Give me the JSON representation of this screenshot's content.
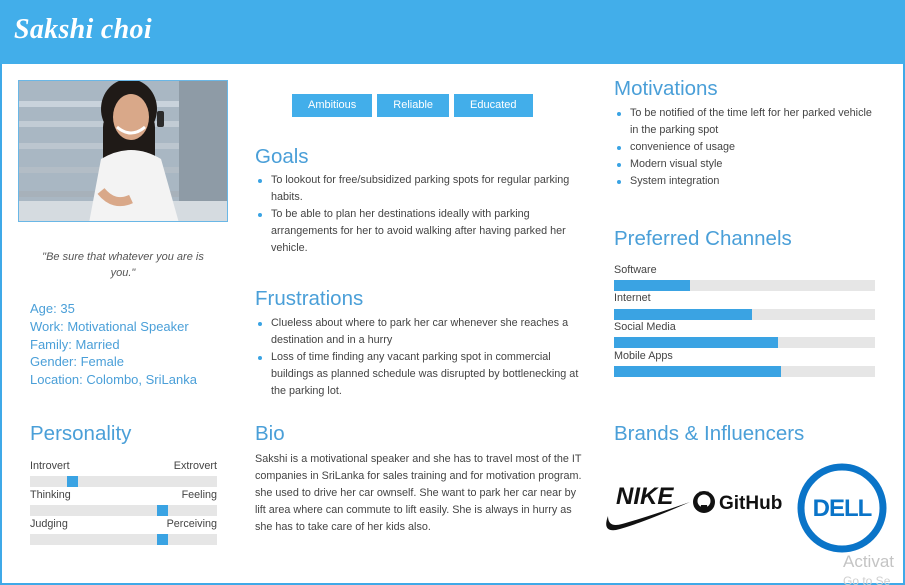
{
  "persona": {
    "name": "Sakshi choi",
    "quote": "\"Be sure that whatever you are is you.\"",
    "facts": [
      "Age: 35",
      "Work: Motivational Speaker",
      "Family: Married",
      "Gender: Female",
      "Location: Colombo, SriLanka"
    ],
    "tags": [
      "Ambitious",
      "Reliable",
      "Educated"
    ]
  },
  "goals": {
    "title": "Goals",
    "items": [
      "To lookout for free/subsidized parking spots for regular parking habits.",
      "To be able to plan her destinations ideally with parking arrangements for her to avoid walking after having parked her vehicle."
    ]
  },
  "frustrations": {
    "title": "Frustrations",
    "items": [
      "Clueless about where to park her car whenever she reaches a destination and in a hurry",
      "Loss of time finding any vacant parking spot in commercial buildings as planned schedule was disrupted by bottlenecking at the parking lot."
    ]
  },
  "motivations": {
    "title": "Motivations",
    "items": [
      "To be notified of the time left for her parked vehicle in the parking spot",
      "convenience of usage",
      "Modern visual style",
      "System integration"
    ]
  },
  "channels": {
    "title": "Preferred Channels",
    "items": [
      {
        "label": "Software",
        "level": 0.29
      },
      {
        "label": "Internet",
        "level": 0.53
      },
      {
        "label": "Social Media",
        "level": 0.63
      },
      {
        "label": "Mobile Apps",
        "level": 0.64
      }
    ]
  },
  "personality": {
    "title": "Personality",
    "traits": [
      {
        "left": "Introvert",
        "right": "Extrovert",
        "level": 0.21
      },
      {
        "left": "Thinking",
        "right": "Feeling",
        "level": 0.72
      },
      {
        "left": "Judging",
        "right": "Perceiving",
        "level": 0.72
      }
    ]
  },
  "bio": {
    "title": "Bio",
    "text": "Sakshi is a motivational speaker  and she has to travel most of the IT companies in SriLanka for sales training and for motivation program. she used to drive her car ownself. She want to park her car near by lift area where can commute to lift easily. She is always in hurry as she has to take care of her kids also."
  },
  "brands": {
    "title": "Brands & Influencers",
    "logos": [
      {
        "name": "nike-logo",
        "text": "NIKE"
      },
      {
        "name": "github-logo",
        "text": "GitHub"
      },
      {
        "name": "dell-logo",
        "text": "DELL"
      }
    ]
  },
  "watermark": {
    "line1": "Activat",
    "line2": "Go to Se"
  },
  "colors": {
    "accent": "#42aeea",
    "bar": "#3aa3e3",
    "track": "#e6e6e6"
  }
}
